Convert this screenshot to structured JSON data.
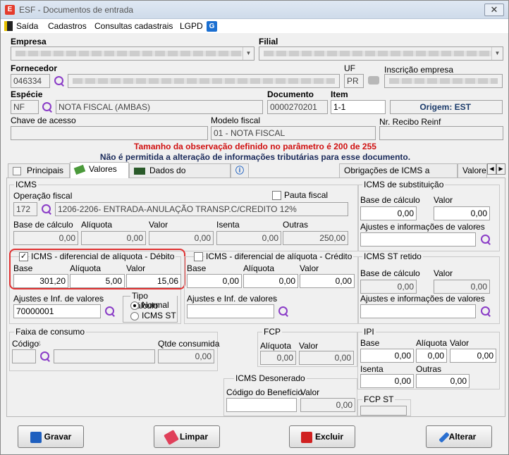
{
  "window": {
    "title": "ESF - Documentos de entrada",
    "close_glyph": "✕"
  },
  "menu": {
    "exit": "Saída",
    "items": [
      "Cadastros",
      "Consultas cadastrais",
      "LGPD"
    ]
  },
  "header": {
    "empresa_label": "Empresa",
    "filial_label": "Filial",
    "fornecedor_label": "Fornecedor",
    "fornecedor_code": "046334",
    "uf_label": "UF",
    "uf_value": "PR",
    "inscricao_label": "Inscrição empresa",
    "especie_label": "Espécie",
    "especie_code": "NF",
    "especie_desc": "NOTA FISCAL (AMBAS)",
    "documento_label": "Documento",
    "documento_value": "0000270201",
    "item_label": "Item",
    "item_value": "1-1",
    "origem_label": "Origem: EST",
    "chave_label": "Chave de acesso",
    "modelo_label": "Modelo fiscal",
    "modelo_value": "01 - NOTA FISCAL",
    "recibo_label": "Nr. Recibo Reinf"
  },
  "warnings": [
    "Tamanho da observação definido no parâmetro é 200 de 255",
    "Não é permitida a alteração de informações tributárias para esse documento."
  ],
  "tabs": [
    "Principais",
    "Valores",
    "Dados do transportador",
    "",
    "Obrigações de ICMS a recolher",
    "Valores"
  ],
  "icms": {
    "title": "ICMS",
    "operacao_label": "Operação fiscal",
    "pauta_label": "Pauta fiscal",
    "operacao_code": "172",
    "operacao_desc": "1206-2206- ENTRADA-ANULAÇÃO TRANSP.C/CREDITO 12%",
    "base_label": "Base de cálculo",
    "aliquota_label": "Alíquota",
    "valor_label": "Valor",
    "isenta_label": "Isenta",
    "outras_label": "Outras",
    "base": "0,00",
    "aliquota": "0,00",
    "valor": "0,00",
    "isenta": "0,00",
    "outras": "250,00"
  },
  "difal_debito": {
    "title": "ICMS - diferencial de alíquota - Débito",
    "checked": "✓",
    "base_label": "Base",
    "aliquota_label": "Alíquota",
    "valor_label": "Valor",
    "base": "301,20",
    "aliquota": "5,00",
    "valor": "15,06",
    "ajustes_label": "Ajustes e Inf. de valores",
    "ajustes_value": "70000001",
    "tipo_label": "Tipo cálculo",
    "opt_normal": "Normal",
    "opt_icms_st": "ICMS ST"
  },
  "difal_credito": {
    "title": "ICMS - diferencial de alíquota - Crédito",
    "base_label": "Base",
    "aliquota_label": "Alíquota",
    "valor_label": "Valor",
    "base": "0,00",
    "aliquota": "0,00",
    "valor": "0,00",
    "ajustes_label": "Ajustes e Inf. de valores"
  },
  "icms_sub": {
    "title": "ICMS de substituição",
    "base_label": "Base de cálculo",
    "valor_label": "Valor",
    "base": "0,00",
    "valor": "0,00",
    "ajustes_label": "Ajustes e informações de valores"
  },
  "icms_st_retido": {
    "title": "ICMS ST retido",
    "base_label": "Base de cálculo",
    "valor_label": "Valor",
    "base": "0,00",
    "valor": "0,00",
    "ajustes_label": "Ajustes e informações de valores"
  },
  "faixa": {
    "title": "Faixa de consumo",
    "codigo_label": "Código",
    "qtde_label": "Qtde consumida",
    "qtde": "0,00"
  },
  "fcp": {
    "title": "FCP",
    "aliquota_label": "Alíquota",
    "valor_label": "Valor",
    "aliquota": "0,00",
    "valor": "0,00"
  },
  "ipi": {
    "title": "IPI",
    "base_label": "Base",
    "aliquota_label": "Alíquota",
    "valor_label": "Valor",
    "isenta_label": "Isenta",
    "outras_label": "Outras",
    "base": "0,00",
    "aliquota": "0,00",
    "valor": "0,00",
    "isenta": "0,00",
    "outras": "0,00"
  },
  "desonerado": {
    "title": "ICMS Desonerado",
    "codigo_label": "Código do Benefício",
    "valor_label": "Valor",
    "valor": "0,00"
  },
  "fcp_st": {
    "title": "FCP ST"
  },
  "buttons": {
    "gravar": "Gravar",
    "limpar": "Limpar",
    "excluir": "Excluir",
    "alterar": "Alterar"
  }
}
